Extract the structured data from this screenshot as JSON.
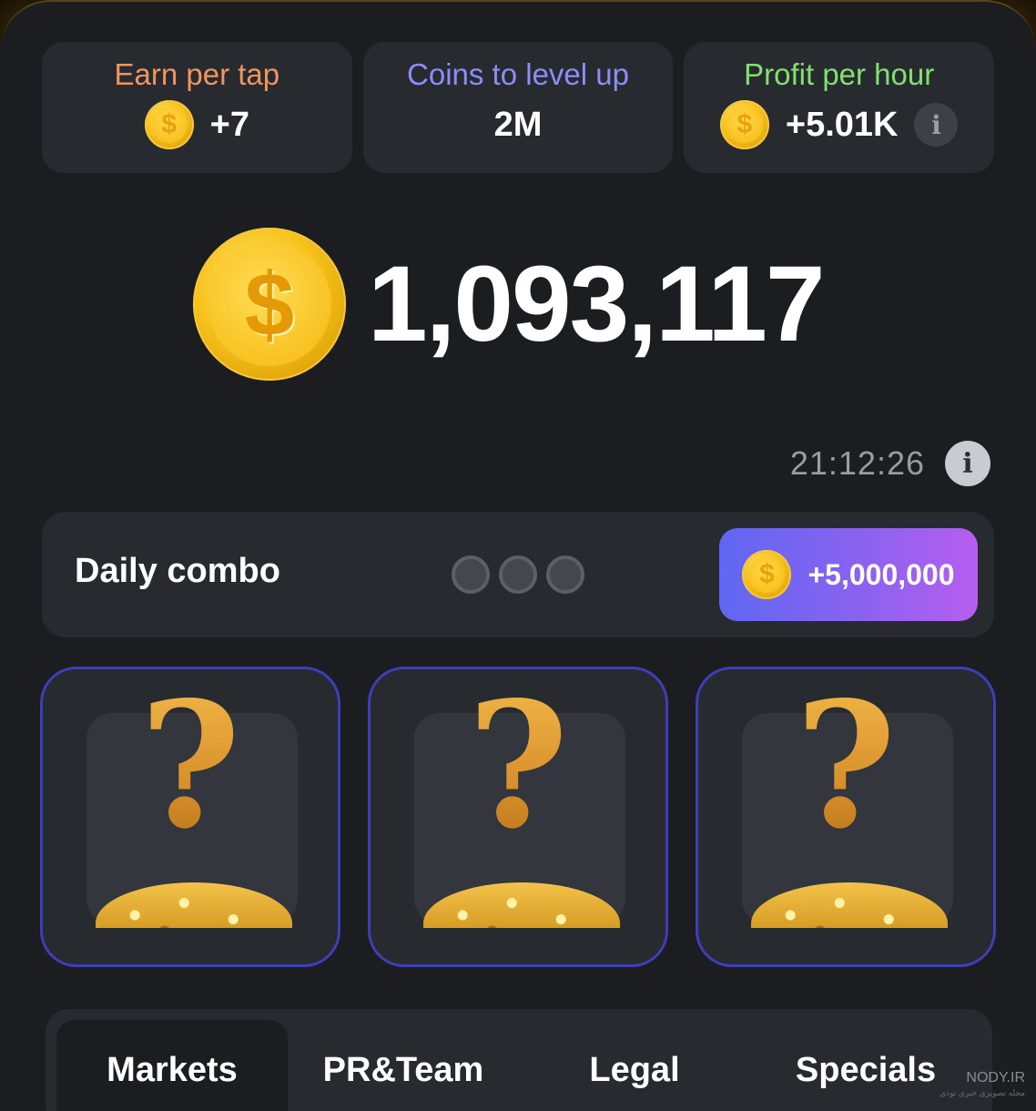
{
  "stats": [
    {
      "label": "Earn per tap",
      "label_color": "#f0955f",
      "value": "+7",
      "icon": "coin-icon"
    },
    {
      "label": "Coins to level up",
      "label_color": "#8b8ff5",
      "value": "2M"
    },
    {
      "label": "Profit per hour",
      "label_color": "#83e06f",
      "value": "+5.01K",
      "icon": "coin-icon",
      "info": "i"
    }
  ],
  "balance": {
    "value": "1,093,117",
    "icon": "coin-icon"
  },
  "timer": {
    "value": "21:12:26",
    "info": "i"
  },
  "daily_combo": {
    "title": "Daily combo",
    "slots_filled": 0,
    "slots_total": 3,
    "reward": "+5,000,000"
  },
  "mystery_cards": [
    {
      "symbol": "?"
    },
    {
      "symbol": "?"
    },
    {
      "symbol": "?"
    }
  ],
  "tabs": [
    {
      "label": "Markets",
      "active": true
    },
    {
      "label": "PR&Team",
      "active": false
    },
    {
      "label": "Legal",
      "active": false
    },
    {
      "label": "Specials",
      "active": false
    }
  ],
  "watermark": {
    "text": "NODY.IR",
    "subtext": "مجله تصویری خبری نودی"
  },
  "colors": {
    "accent_gold": "#f5b90f",
    "card_bg": "#272a2f",
    "panel_bg": "#1c1d21",
    "card_border": "#3d3fb8"
  }
}
